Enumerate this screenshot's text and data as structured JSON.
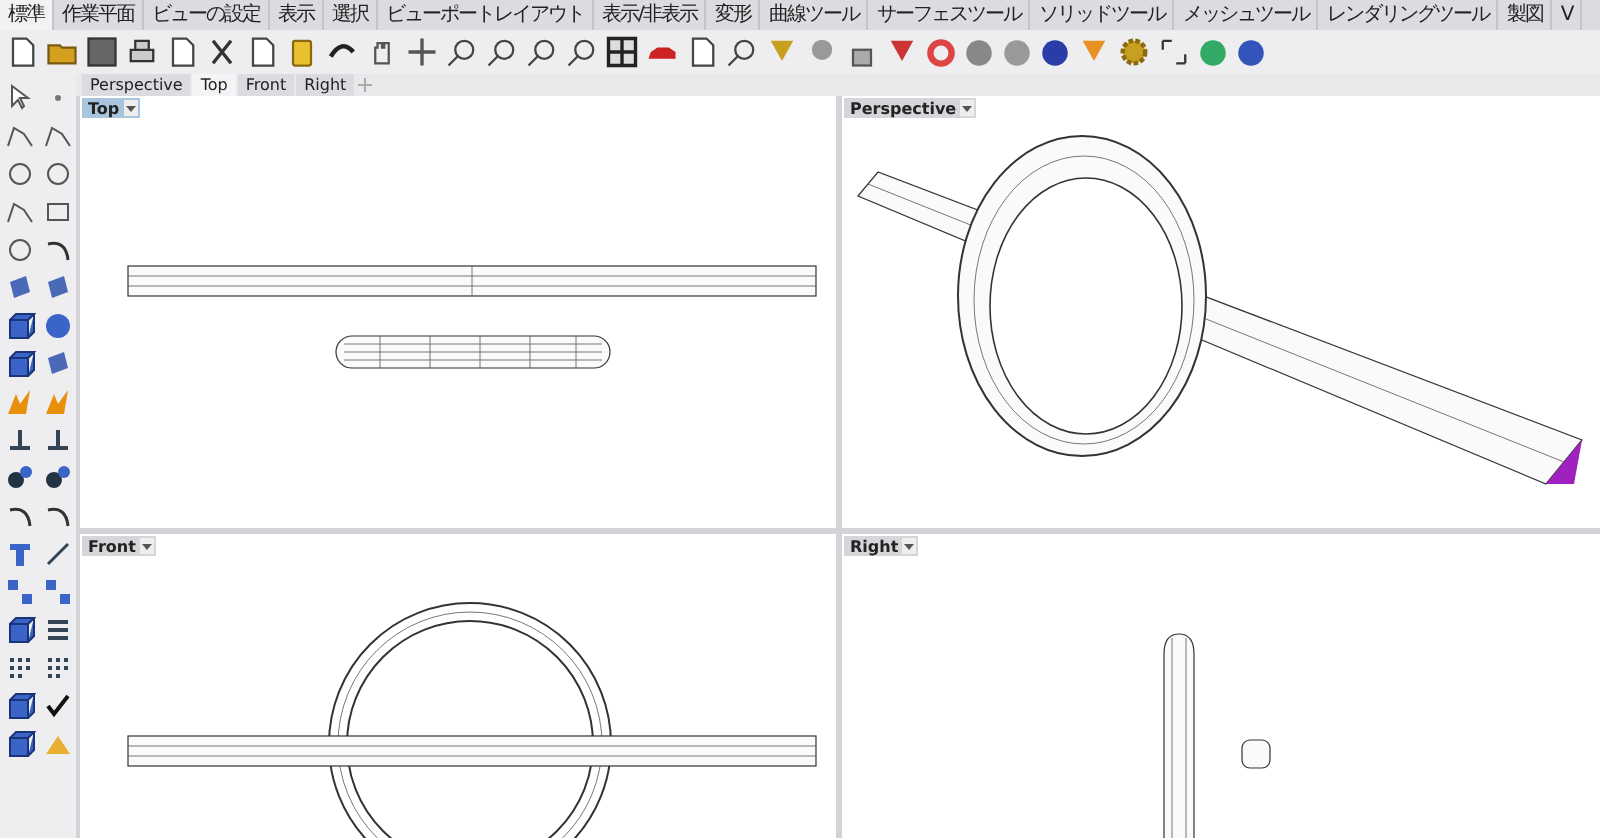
{
  "ribbon_tabs": [
    {
      "label": "標準",
      "selected": true
    },
    {
      "label": "作業平面",
      "selected": false
    },
    {
      "label": "ビューの設定",
      "selected": false
    },
    {
      "label": "表示",
      "selected": false
    },
    {
      "label": "選択",
      "selected": false
    },
    {
      "label": "ビューポートレイアウト",
      "selected": false
    },
    {
      "label": "表示/非表示",
      "selected": false
    },
    {
      "label": "変形",
      "selected": false
    },
    {
      "label": "曲線ツール",
      "selected": false
    },
    {
      "label": "サーフェスツール",
      "selected": false
    },
    {
      "label": "ソリッドツール",
      "selected": false
    },
    {
      "label": "メッシュツール",
      "selected": false
    },
    {
      "label": "レンダリングツール",
      "selected": false
    },
    {
      "label": "製図",
      "selected": false
    },
    {
      "label": "V",
      "selected": false
    }
  ],
  "viewport_tabs": [
    {
      "label": "Perspective",
      "selected": false
    },
    {
      "label": "Top",
      "selected": true
    },
    {
      "label": "Front",
      "selected": false
    },
    {
      "label": "Right",
      "selected": false
    }
  ],
  "viewports": [
    {
      "kind": "top",
      "label": "Top",
      "selected": true
    },
    {
      "kind": "perspective",
      "label": "Perspective",
      "selected": false
    },
    {
      "kind": "front",
      "label": "Front",
      "selected": false
    },
    {
      "kind": "right",
      "label": "Right",
      "selected": false
    }
  ]
}
